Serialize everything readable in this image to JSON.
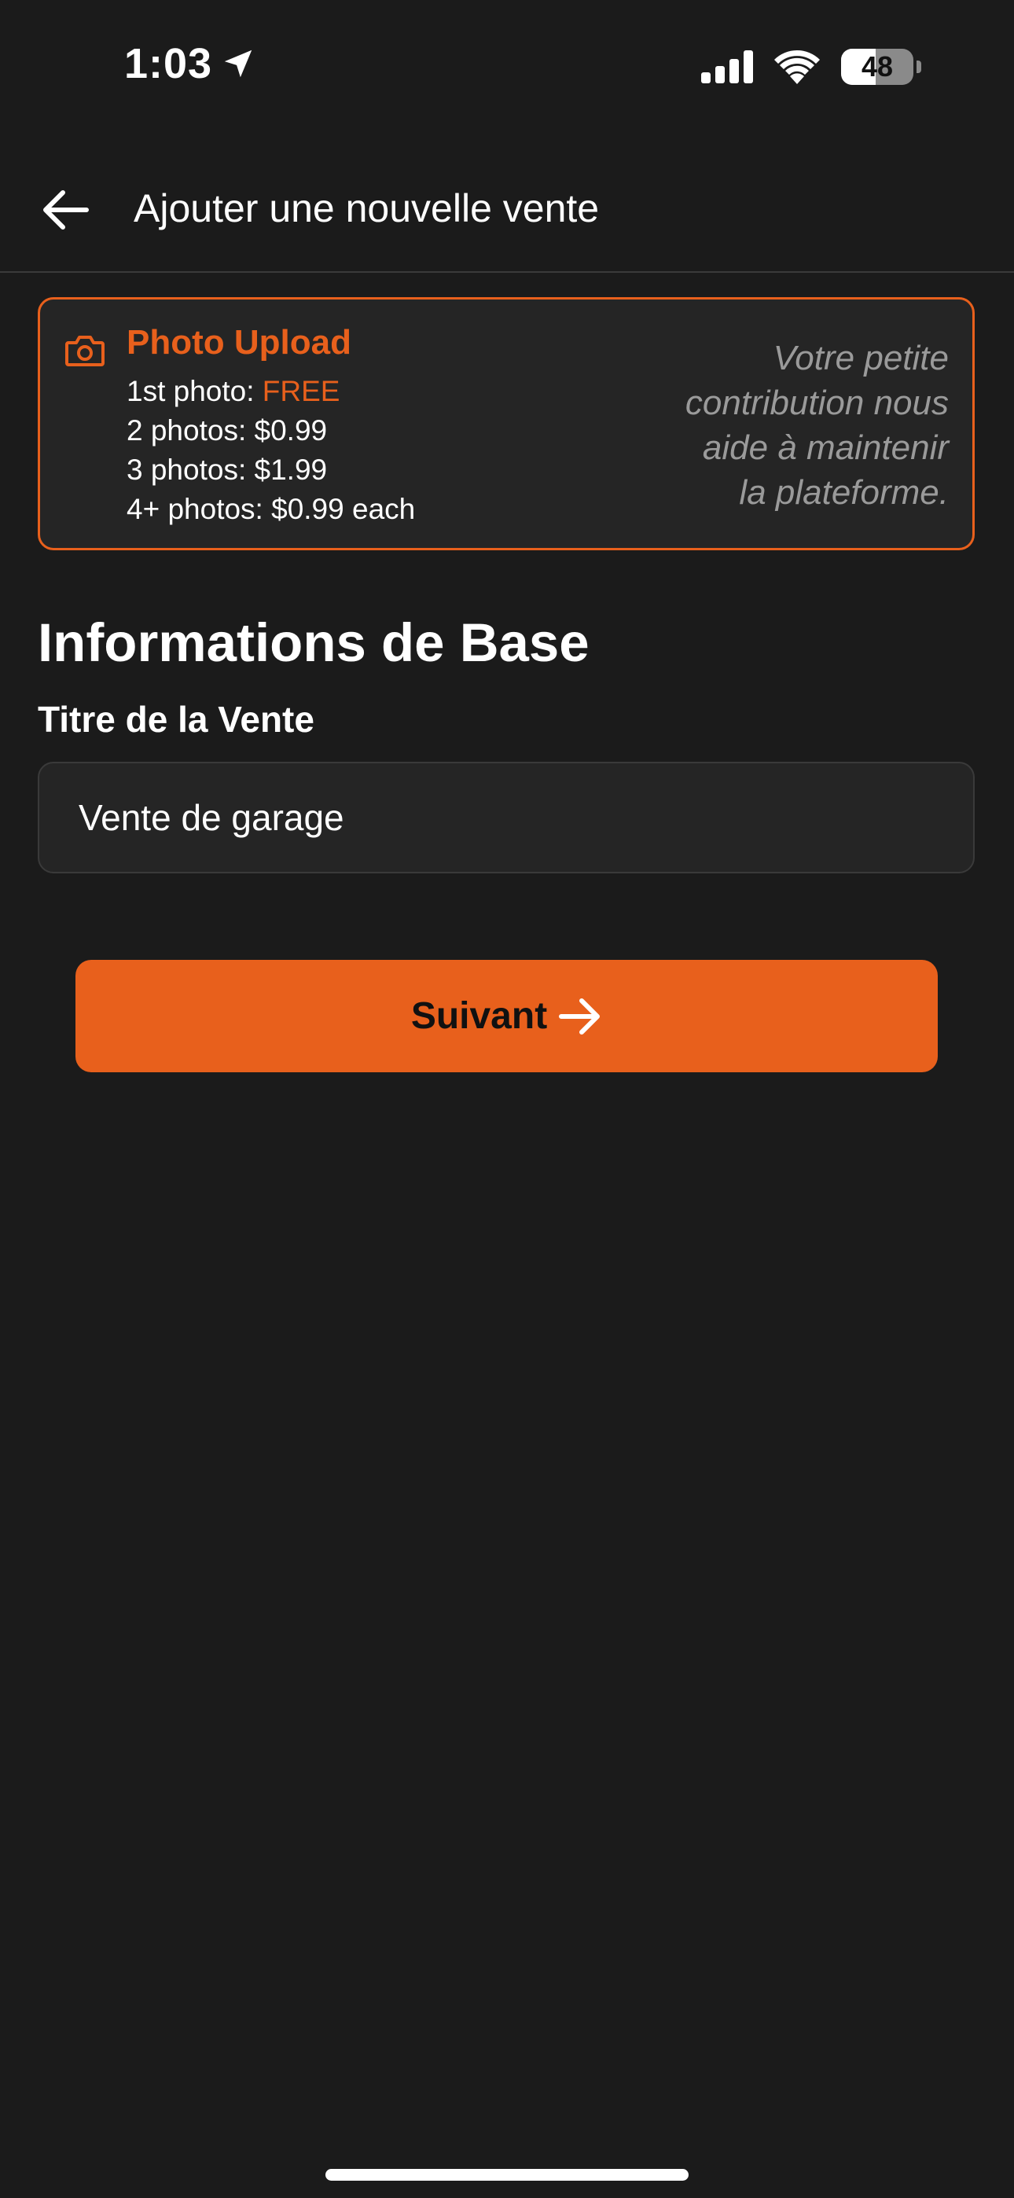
{
  "status_bar": {
    "time": "1:03",
    "battery_level": "48",
    "battery_fraction": 0.48
  },
  "header": {
    "title": "Ajouter une nouvelle vente"
  },
  "photo_upload": {
    "title": "Photo Upload",
    "prices": [
      {
        "label": "1st photo: ",
        "value": "FREE",
        "highlight": true
      },
      {
        "label": "2 photos: ",
        "value": "$0.99",
        "highlight": false
      },
      {
        "label": "3 photos: ",
        "value": "$1.99",
        "highlight": false
      },
      {
        "label": "4+ photos: ",
        "value": "$0.99 each",
        "highlight": false
      }
    ],
    "note_lines": [
      "Votre petite",
      "contribution nous",
      "aide à maintenir",
      "la plateforme."
    ]
  },
  "basic_info": {
    "section_title": "Informations de Base",
    "field_label": "Titre de la Vente",
    "title_value": "Vente de garage"
  },
  "next_button": {
    "label": "Suivant"
  },
  "icons": {
    "back": "arrow-left-icon",
    "camera": "camera-icon",
    "next": "arrow-right-icon",
    "location": "location-arrow-icon",
    "signal": "cellular-signal-icon",
    "wifi": "wifi-icon",
    "battery": "battery-icon"
  },
  "colors": {
    "background": "#1b1b1b",
    "accent": "#e8601c",
    "card": "#252525",
    "muted_text": "#9a9a9a"
  }
}
